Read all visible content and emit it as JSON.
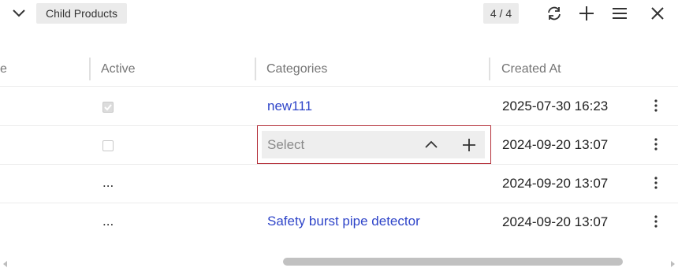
{
  "header": {
    "title": "Child Products",
    "counter": "4 / 4",
    "icons": [
      "chevron-down-icon",
      "refresh-icon",
      "plus-icon",
      "menu-icon",
      "close-icon"
    ]
  },
  "columns": {
    "partial": "e",
    "active": "Active",
    "categories": "Categories",
    "created_at": "Created At"
  },
  "rows": [
    {
      "active": "checked",
      "categories": "new111",
      "created_at": "2025-07-30 16:23"
    },
    {
      "active": "unchecked",
      "categories": "",
      "created_at": "2024-09-20 13:07"
    },
    {
      "active": "...",
      "categories": "",
      "created_at": "2024-09-20 13:07"
    },
    {
      "active": "...",
      "categories": "Safety burst pipe detector",
      "created_at": "2024-09-20 13:07"
    }
  ],
  "editor": {
    "placeholder": "Select",
    "value": ""
  },
  "colors": {
    "link": "#2f45c9",
    "editor_border": "#b4303a",
    "header_pill": "#ebebeb"
  }
}
